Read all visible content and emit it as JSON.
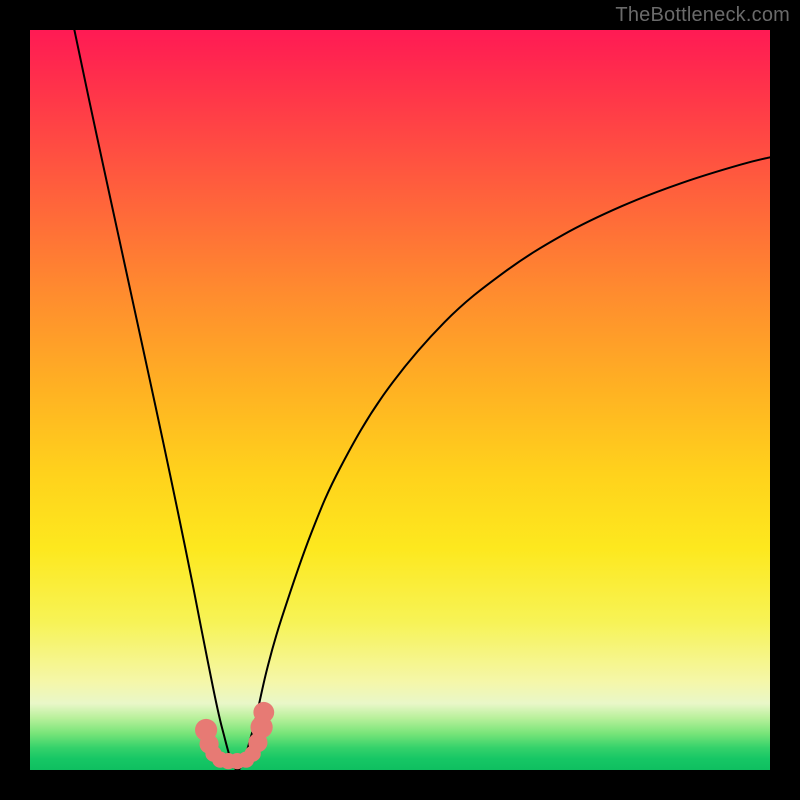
{
  "watermark": "TheBottleneck.com",
  "colors": {
    "frame": "#000000",
    "curve": "#000000",
    "marker": "#e77a74",
    "gradient_top": "#ff1a54",
    "gradient_bottom": "#0fbf60"
  },
  "chart_data": {
    "type": "line",
    "title": "",
    "xlabel": "",
    "ylabel": "",
    "xlim": [
      0,
      1
    ],
    "ylim": [
      0,
      1
    ],
    "note": "Unlabeled V-shaped bottleneck curve over a red-orange-yellow-green vertical gradient. x and y are normalized 0–1 (no axis ticks shown). Minimum at x≈0.28, y≈0.",
    "min_x": 0.28,
    "series": [
      {
        "name": "curve",
        "x": [
          0.06,
          0.08,
          0.1,
          0.12,
          0.14,
          0.16,
          0.18,
          0.2,
          0.22,
          0.24,
          0.26,
          0.28,
          0.3,
          0.32,
          0.34,
          0.38,
          0.42,
          0.48,
          0.56,
          0.64,
          0.72,
          0.8,
          0.88,
          0.96,
          1.0
        ],
        "y": [
          1.0,
          0.905,
          0.812,
          0.72,
          0.628,
          0.536,
          0.443,
          0.348,
          0.25,
          0.148,
          0.055,
          0.0,
          0.05,
          0.135,
          0.205,
          0.32,
          0.41,
          0.51,
          0.605,
          0.672,
          0.723,
          0.762,
          0.793,
          0.818,
          0.828
        ]
      }
    ],
    "markers": [
      {
        "x": 0.238,
        "y": 0.054,
        "r": 0.015
      },
      {
        "x": 0.242,
        "y": 0.035,
        "r": 0.013
      },
      {
        "x": 0.248,
        "y": 0.022,
        "r": 0.011
      },
      {
        "x": 0.257,
        "y": 0.014,
        "r": 0.011
      },
      {
        "x": 0.268,
        "y": 0.012,
        "r": 0.011
      },
      {
        "x": 0.28,
        "y": 0.012,
        "r": 0.011
      },
      {
        "x": 0.292,
        "y": 0.014,
        "r": 0.011
      },
      {
        "x": 0.301,
        "y": 0.022,
        "r": 0.011
      },
      {
        "x": 0.308,
        "y": 0.037,
        "r": 0.013
      },
      {
        "x": 0.313,
        "y": 0.058,
        "r": 0.015
      },
      {
        "x": 0.316,
        "y": 0.078,
        "r": 0.014
      }
    ]
  }
}
